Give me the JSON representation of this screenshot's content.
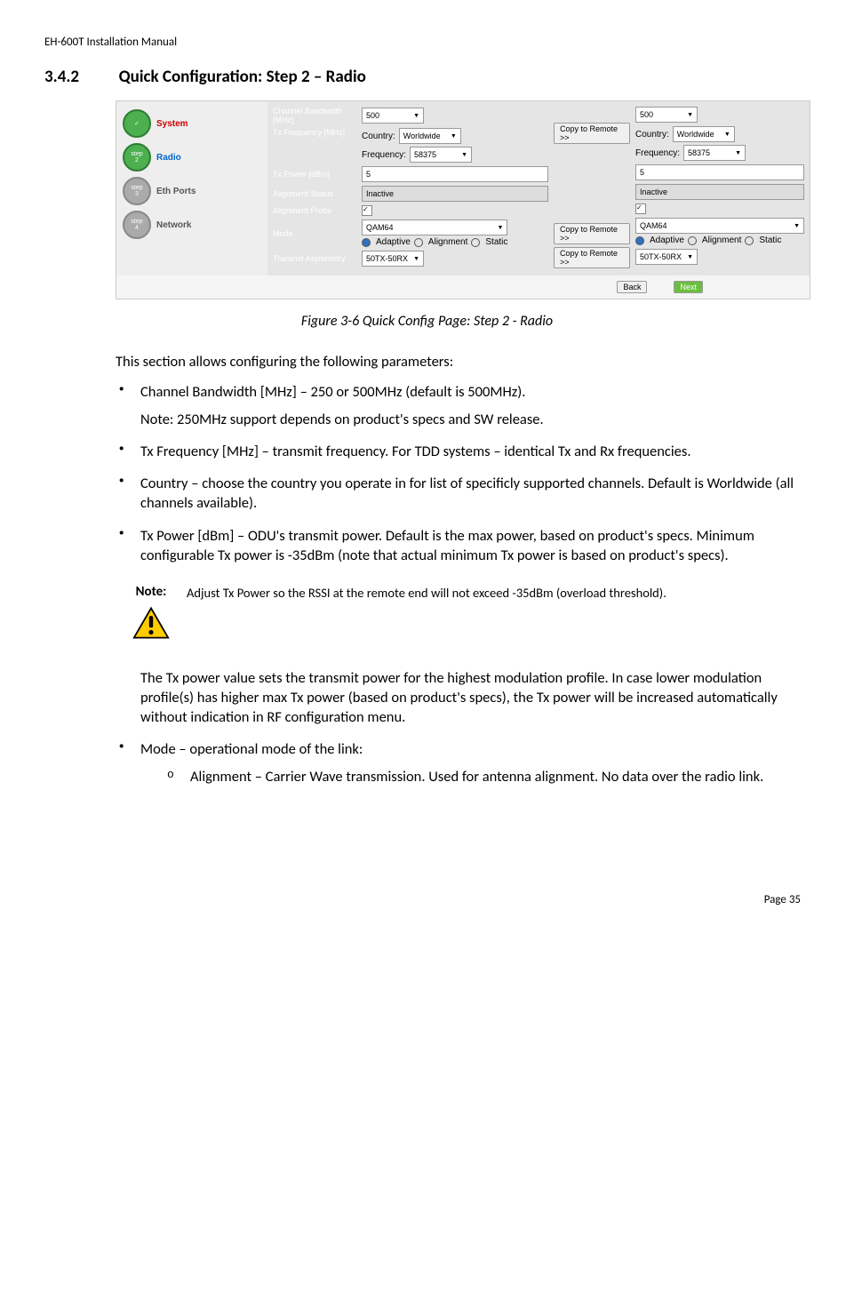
{
  "header": "EH-600T Installation Manual",
  "section": {
    "number": "3.4.2",
    "title": "Quick Configuration: Step 2 – Radio"
  },
  "screenshot": {
    "sidebar": {
      "items": [
        {
          "badge": "✓",
          "label": "System",
          "cls": "system",
          "badgeCls": "done"
        },
        {
          "badge": "step\n2",
          "label": "Radio",
          "cls": "radio",
          "badgeCls": "active"
        },
        {
          "badge": "step\n3",
          "label": "Eth Ports",
          "cls": "",
          "badgeCls": ""
        },
        {
          "badge": "step\n4",
          "label": "Network",
          "cls": "",
          "badgeCls": ""
        }
      ]
    },
    "fields": {
      "channel_bw_label": "Channel Bandwidth [MHz]",
      "channel_bw_value": "500",
      "tx_freq_label": "Tx Frequency [MHz]",
      "country_label": "Country:",
      "country_value": "Worldwide",
      "frequency_label": "Frequency:",
      "frequency_value": "58375",
      "tx_power_label": "Tx Power [dBm]",
      "tx_power_value": "5",
      "align_status_label": "Alignment Status",
      "align_status_value": "Inactive",
      "align_probe_label": "Alignment Probe",
      "mode_label": "Mode",
      "mode_value": "QAM64",
      "mode_options": [
        "Adaptive",
        "Alignment",
        "Static"
      ],
      "transmit_asym_label": "Transmit Asymmetry",
      "transmit_asym_value": "50TX-50RX",
      "copy_btn": "Copy to Remote >>",
      "back_btn": "Back",
      "next_btn": "Next"
    }
  },
  "figure_caption": "Figure 3-6 Quick Config Page: Step 2 - Radio",
  "intro": "This section allows configuring the following parameters:",
  "bullets": [
    {
      "main": "Channel Bandwidth [MHz] – 250 or 500MHz (default is 500MHz).",
      "sub": "Note: 250MHz support depends on product's specs and SW release."
    },
    {
      "main": "Tx Frequency [MHz] – transmit frequency. For TDD systems – identical Tx and Rx frequencies."
    },
    {
      "main": "Country – choose the country you operate in for list of specificly supported channels. Default is Worldwide (all channels available)."
    },
    {
      "main": "Tx Power [dBm] – ODU's transmit power. Default is the max power, based on product's specs. Minimum configurable Tx power is -35dBm (note that actual minimum Tx power is based on product's specs)."
    }
  ],
  "note": {
    "label": "Note:",
    "text": "Adjust Tx Power so the RSSI at the remote end will not exceed -35dBm (overload threshold)."
  },
  "after_note": "The Tx power value sets the transmit power for the highest modulation profile. In case lower modulation profile(s) has higher max Tx power (based on product's specs), the Tx power will be increased automatically without indication in RF configuration menu.",
  "bullets2": [
    {
      "main": "Mode – operational mode of the link:",
      "sub_items": [
        "Alignment – Carrier Wave transmission. Used for antenna alignment. No data over the radio link."
      ]
    }
  ],
  "page_number": "Page 35"
}
